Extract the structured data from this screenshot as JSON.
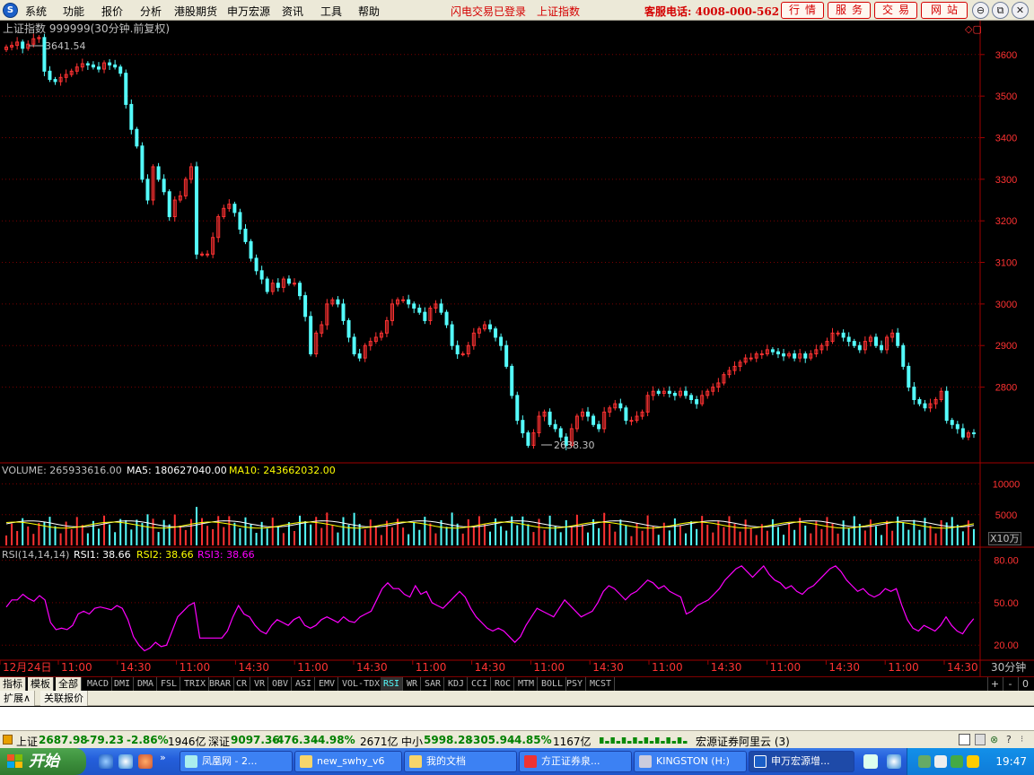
{
  "menu": {
    "logo": "S",
    "items": [
      "系统",
      "功能",
      "报价",
      "分析",
      "港股期货",
      "申万宏源",
      "资讯",
      "工具",
      "帮助"
    ],
    "status_login": "闪电交易已登录",
    "status_index": "上证指数",
    "hotline": "客服电话: 4008-000-562",
    "buttons": [
      "行情",
      "服务",
      "交易",
      "网站"
    ],
    "window_controls": [
      "⊖",
      "⧉",
      "✕"
    ]
  },
  "chart_header": {
    "title": "上证指数 999999(30分钟.前复权)",
    "high_marker": "3641.54",
    "low_marker": "2638.30",
    "corner_icons": "◇▢"
  },
  "volume_header": {
    "label": "VOLUME: 265933616.00",
    "ma5": "MA5: 180627040.00",
    "ma10": "MA10: 243662032.00",
    "unit": "X10万"
  },
  "rsi_header": {
    "label": "RSI(14,14,14)",
    "rsi1": "RSI1: 38.66",
    "rsi2": "RSI2: 38.66",
    "rsi3": "RSI3: 38.66"
  },
  "time_axis": {
    "labels": [
      "12月24日",
      "11:00",
      "14:30",
      "11:00",
      "14:30",
      "11:00",
      "14:30",
      "11:00",
      "14:30",
      "11:00",
      "14:30",
      "11:00",
      "14:30",
      "11:00",
      "14:30",
      "11:00",
      "14:30"
    ],
    "period": "30分钟"
  },
  "indicator_tabs": {
    "lead": [
      "指标",
      "模板",
      "全部"
    ],
    "items": [
      "MACD",
      "DMI",
      "DMA",
      "FSL",
      "TRIX",
      "BRAR",
      "CR",
      "VR",
      "OBV",
      "ASI",
      "EMV",
      "VOL-TDX",
      "RSI",
      "WR",
      "SAR",
      "KDJ",
      "CCI",
      "ROC",
      "MTM",
      "BOLL",
      "PSY",
      "MCST"
    ],
    "active": "RSI",
    "right_buttons": [
      "+",
      "-",
      "0"
    ]
  },
  "sub_tabs": [
    "扩展∧",
    "关联报价"
  ],
  "status_bar": {
    "sh": {
      "name": "上证",
      "price": "2687.98",
      "change": "-79.23",
      "pct": "-2.86%",
      "amount": "1946亿"
    },
    "sz": {
      "name": "深证",
      "price": "9097.36",
      "change": "-476.34",
      "pct": "-4.98%",
      "amount": "2671亿"
    },
    "zx": {
      "name": "中小",
      "price": "5998.28",
      "change": "-305.94",
      "pct": "-4.85%",
      "amount": "1167亿"
    },
    "broker": "宏源证券阿里云 (3)"
  },
  "taskbar": {
    "start": "开始",
    "tasks": [
      "凤凰网 - 2...",
      "new_swhy_v6",
      "我的文档",
      "方正证券泉...",
      "KINGSTON (H:)",
      "申万宏源增..."
    ],
    "active_task": 5,
    "clock": "19:47"
  },
  "chart_data": [
    {
      "type": "candlestick",
      "title": "上证指数 999999(30分钟.前复权)",
      "y_ticks": [
        3600,
        3500,
        3400,
        3300,
        3200,
        3100,
        3000,
        2900,
        2800
      ],
      "ylim": [
        2620,
        3660
      ],
      "annotations": [
        {
          "label": "3641.54",
          "kind": "high"
        },
        {
          "label": "2638.30",
          "kind": "low"
        }
      ],
      "x_ticks": [
        "12月24日",
        "11:00",
        "14:30",
        "11:00",
        "14:30",
        "11:00",
        "14:30",
        "11:00",
        "14:30",
        "11:00",
        "14:30",
        "11:00",
        "14:30",
        "11:00",
        "14:30",
        "11:00",
        "14:30"
      ],
      "colors": {
        "up": "#ff3232",
        "down": "#54fcfc"
      },
      "series": [
        {
          "close": [
            3618,
            3622,
            3630,
            3615,
            3625,
            3638,
            3641,
            3560,
            3540,
            3535,
            3545,
            3552,
            3560,
            3570,
            3578,
            3575,
            3570,
            3565,
            3580,
            3575,
            3570,
            3555,
            3480,
            3420,
            3380,
            3300,
            3250,
            3330,
            3300,
            3270,
            3210,
            3250,
            3260,
            3300,
            3330,
            3120,
            3120,
            3120,
            3160,
            3210,
            3230,
            3240,
            3220,
            3180,
            3150,
            3110,
            3080,
            3060,
            3030,
            3050,
            3040,
            3060,
            3050,
            3050,
            3020,
            2970,
            2880,
            2930,
            2950,
            3000,
            3010,
            3000,
            2960,
            2920,
            2880,
            2870,
            2900,
            2910,
            2920,
            2930,
            2960,
            3000,
            3010,
            3010,
            3000,
            2990,
            2980,
            2960,
            2990,
            3000,
            2980,
            2950,
            2900,
            2880,
            2880,
            2900,
            2930,
            2940,
            2950,
            2940,
            2920,
            2900,
            2850,
            2780,
            2720,
            2690,
            2660,
            2690,
            2730,
            2740,
            2710,
            2700,
            2680,
            2660,
            2700,
            2730,
            2740,
            2730,
            2710,
            2700,
            2740,
            2750,
            2760,
            2750,
            2720,
            2720,
            2730,
            2740,
            2780,
            2790,
            2785,
            2790,
            2785,
            2780,
            2790,
            2780,
            2770,
            2760,
            2780,
            2790,
            2800,
            2810,
            2830,
            2840,
            2850,
            2860,
            2870,
            2870,
            2880,
            2880,
            2890,
            2885,
            2880,
            2875,
            2880,
            2870,
            2880,
            2870,
            2880,
            2890,
            2900,
            2910,
            2930,
            2930,
            2920,
            2910,
            2900,
            2890,
            2910,
            2920,
            2900,
            2890,
            2920,
            2930,
            2900,
            2850,
            2800,
            2770,
            2760,
            2750,
            2760,
            2770,
            2790,
            2720,
            2710,
            2700,
            2680,
            2690,
            2687.98
          ]
        }
      ]
    },
    {
      "type": "bar",
      "title": "VOLUME",
      "unit": "X10万",
      "y_ticks": [
        10000,
        5000
      ],
      "ylim": [
        0,
        13000
      ],
      "legend": [
        "VOLUME: 265933616.00",
        "MA5: 180627040.00",
        "MA10: 243662032.00"
      ],
      "series": [
        {
          "name": "MA5",
          "color": "#ffffff",
          "level": 3500
        },
        {
          "name": "MA10",
          "color": "#ffff00",
          "level": 3300
        }
      ]
    },
    {
      "type": "line",
      "title": "RSI(14,14,14)",
      "y_ticks": [
        80,
        50,
        20
      ],
      "ylim": [
        10,
        88
      ],
      "series": [
        {
          "name": "RSI3",
          "color": "#ff00ff",
          "values": [
            47,
            52,
            52,
            56,
            53,
            51,
            55,
            52,
            36,
            31,
            32,
            31,
            34,
            42,
            44,
            42,
            46,
            47,
            46,
            45,
            48,
            46,
            38,
            26,
            20,
            16,
            18,
            22,
            19,
            20,
            30,
            40,
            44,
            48,
            50,
            25,
            25,
            25,
            25,
            25,
            30,
            40,
            48,
            42,
            40,
            34,
            30,
            28,
            34,
            38,
            36,
            34,
            38,
            40,
            34,
            32,
            34,
            38,
            40,
            38,
            36,
            40,
            37,
            36,
            40,
            42,
            44,
            52,
            60,
            64,
            60,
            60,
            56,
            54,
            62,
            56,
            58,
            50,
            48,
            46,
            50,
            54,
            58,
            54,
            46,
            40,
            36,
            32,
            30,
            32,
            30,
            26,
            22,
            26,
            34,
            40,
            46,
            44,
            42,
            40,
            46,
            52,
            48,
            44,
            40,
            42,
            44,
            50,
            58,
            62,
            60,
            56,
            52,
            56,
            58,
            62,
            66,
            64,
            60,
            62,
            58,
            56,
            54,
            42,
            44,
            48,
            50,
            52,
            56,
            60,
            66,
            70,
            74,
            76,
            72,
            68,
            72,
            76,
            70,
            66,
            64,
            60,
            62,
            58,
            56,
            60,
            62,
            66,
            70,
            74,
            76,
            72,
            66,
            62,
            58,
            60,
            56,
            54,
            56,
            60,
            58,
            60,
            48,
            38,
            32,
            30,
            34,
            32,
            30,
            34,
            40,
            34,
            30,
            28,
            34,
            38.66
          ]
        }
      ]
    }
  ]
}
